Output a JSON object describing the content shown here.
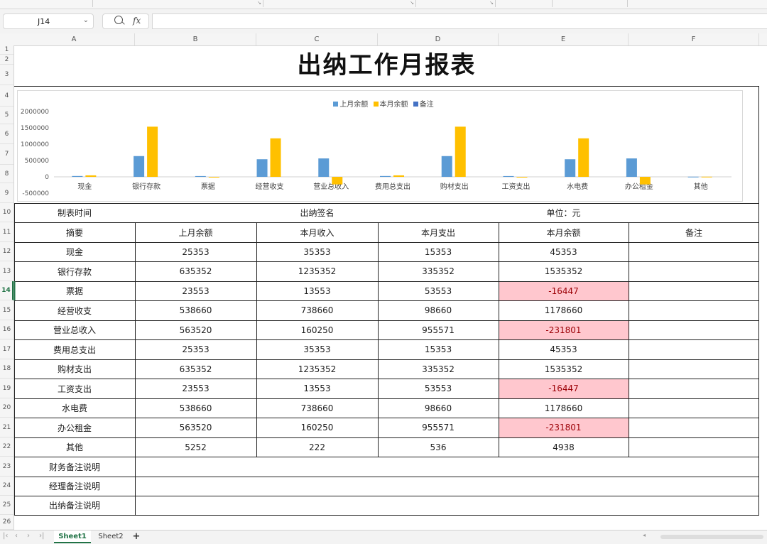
{
  "formula_bar": {
    "name_box": "J14",
    "fx_label": "fx"
  },
  "columns": [
    "A",
    "B",
    "C",
    "D",
    "E",
    "F"
  ],
  "rows": [
    "1",
    "2",
    "3",
    "4",
    "5",
    "6",
    "7",
    "8",
    "9",
    "10",
    "11",
    "12",
    "13",
    "14",
    "15",
    "16",
    "17",
    "18",
    "19",
    "20",
    "21",
    "22",
    "23",
    "24",
    "25",
    "26"
  ],
  "sheet": {
    "title": "出纳工作月报表",
    "meta": {
      "made_time": "制表时间",
      "cashier_sign": "出纳签名",
      "unit": "单位：元"
    },
    "headers": [
      "摘要",
      "上月余额",
      "本月收入",
      "本月支出",
      "本月余额",
      "备注"
    ],
    "rows": [
      {
        "name": "现金",
        "prev": "25353",
        "inc": "35353",
        "exp": "15353",
        "bal": "45353",
        "neg": false
      },
      {
        "name": "银行存款",
        "prev": "635352",
        "inc": "1235352",
        "exp": "335352",
        "bal": "1535352",
        "neg": false
      },
      {
        "name": "票据",
        "prev": "23553",
        "inc": "13553",
        "exp": "53553",
        "bal": "-16447",
        "neg": true
      },
      {
        "name": "经营收支",
        "prev": "538660",
        "inc": "738660",
        "exp": "98660",
        "bal": "1178660",
        "neg": false
      },
      {
        "name": "营业总收入",
        "prev": "563520",
        "inc": "160250",
        "exp": "955571",
        "bal": "-231801",
        "neg": true
      },
      {
        "name": "费用总支出",
        "prev": "25353",
        "inc": "35353",
        "exp": "15353",
        "bal": "45353",
        "neg": false
      },
      {
        "name": "购材支出",
        "prev": "635352",
        "inc": "1235352",
        "exp": "335352",
        "bal": "1535352",
        "neg": false
      },
      {
        "name": "工资支出",
        "prev": "23553",
        "inc": "13553",
        "exp": "53553",
        "bal": "-16447",
        "neg": true
      },
      {
        "name": "水电费",
        "prev": "538660",
        "inc": "738660",
        "exp": "98660",
        "bal": "1178660",
        "neg": false
      },
      {
        "name": "办公租金",
        "prev": "563520",
        "inc": "160250",
        "exp": "955571",
        "bal": "-231801",
        "neg": true
      },
      {
        "name": "其他",
        "prev": "5252",
        "inc": "222",
        "exp": "536",
        "bal": "4938",
        "neg": false
      }
    ],
    "notes": [
      "财务备注说明",
      "经理备注说明",
      "出纳备注说明"
    ]
  },
  "tabs": {
    "sheets": [
      "Sheet1",
      "Sheet2"
    ],
    "add": "+"
  },
  "chart_data": {
    "type": "bar",
    "categories": [
      "现金",
      "银行存款",
      "票据",
      "经营收支",
      "营业总收入",
      "费用总支出",
      "购材支出",
      "工资支出",
      "水电费",
      "办公租金",
      "其他"
    ],
    "series": [
      {
        "name": "上月余额",
        "color": "#5b9bd5",
        "values": [
          25353,
          635352,
          23553,
          538660,
          563520,
          25353,
          635352,
          23553,
          538660,
          563520,
          5252
        ]
      },
      {
        "name": "本月余额",
        "color": "#ffc000",
        "values": [
          45353,
          1535352,
          -16447,
          1178660,
          -231801,
          45353,
          1535352,
          -16447,
          1178660,
          -231801,
          4938
        ]
      },
      {
        "name": "备注",
        "color": "#4472c4",
        "values": []
      }
    ],
    "ylim": [
      -500000,
      2000000
    ],
    "yticks": [
      "2000000",
      "1500000",
      "1000000",
      "500000",
      "0",
      "-500000"
    ],
    "ytick_values": [
      2000000,
      1500000,
      1000000,
      500000,
      0,
      -500000
    ],
    "legend": "top",
    "grid": false
  }
}
